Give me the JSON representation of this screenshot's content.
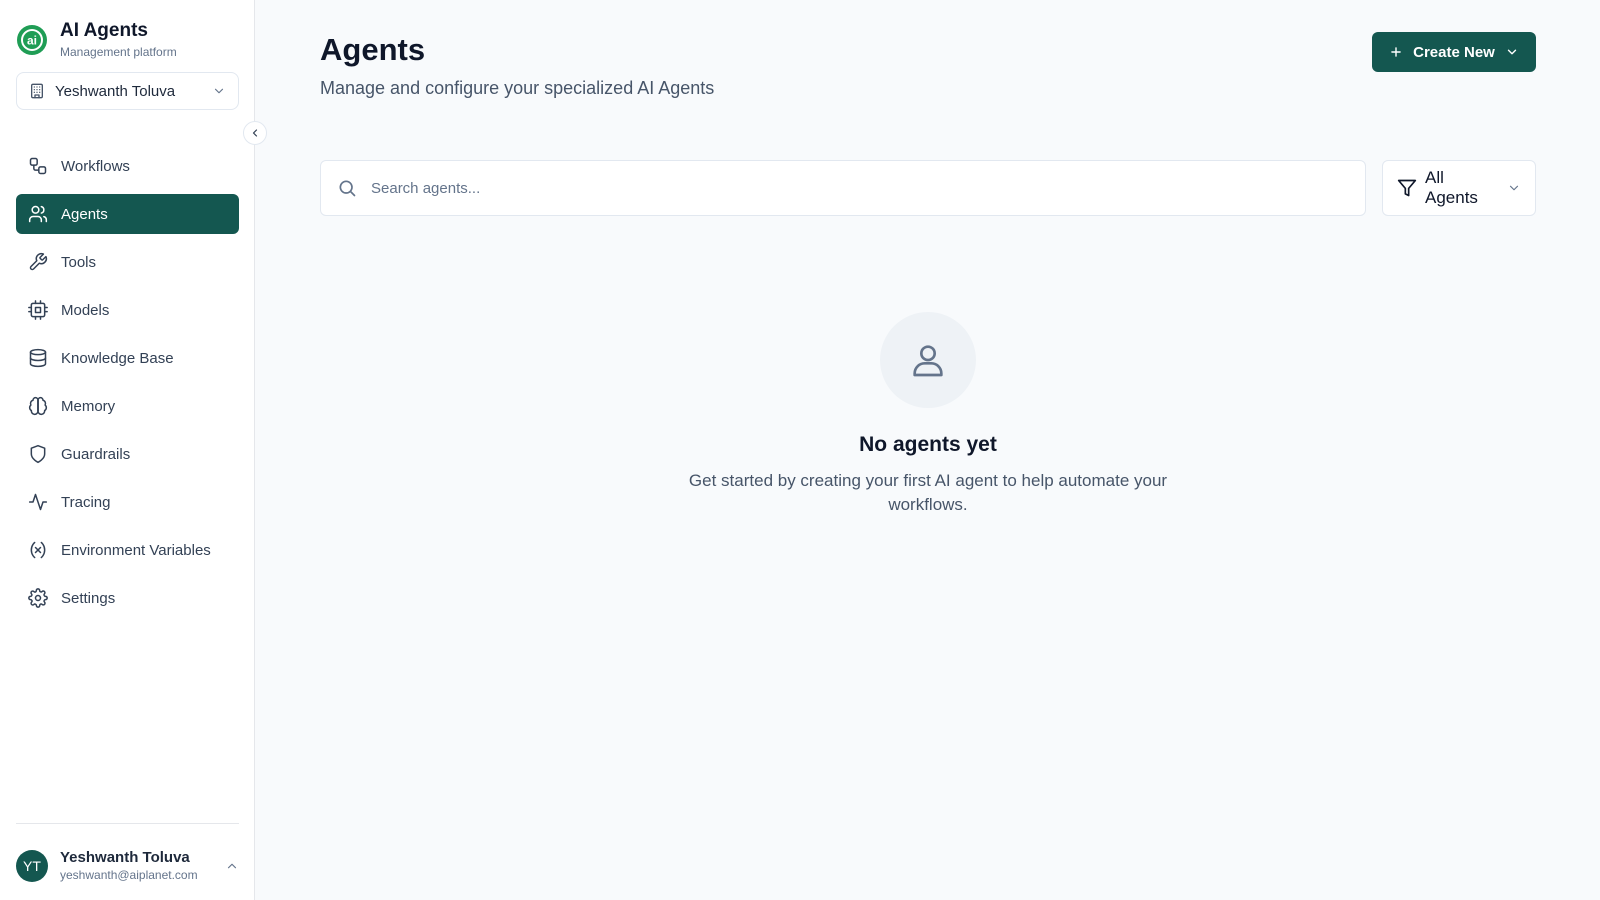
{
  "brand": {
    "title": "AI Agents",
    "subtitle": "Management platform",
    "logo_text": "ai",
    "color": "#1f9d55"
  },
  "org_selector": {
    "value": "Yeshwanth Toluva",
    "icon": "building-icon"
  },
  "sidebar": {
    "items": [
      {
        "label": "Workflows",
        "icon": "workflow-icon",
        "active": false
      },
      {
        "label": "Agents",
        "icon": "users-icon",
        "active": true
      },
      {
        "label": "Tools",
        "icon": "wrench-icon",
        "active": false
      },
      {
        "label": "Models",
        "icon": "cpu-icon",
        "active": false
      },
      {
        "label": "Knowledge Base",
        "icon": "database-icon",
        "active": false
      },
      {
        "label": "Memory",
        "icon": "brain-icon",
        "active": false
      },
      {
        "label": "Guardrails",
        "icon": "shield-icon",
        "active": false
      },
      {
        "label": "Tracing",
        "icon": "activity-icon",
        "active": false
      },
      {
        "label": "Environment Variables",
        "icon": "variable-icon",
        "active": false
      },
      {
        "label": "Settings",
        "icon": "gear-icon",
        "active": false
      }
    ]
  },
  "user": {
    "initials": "YT",
    "name": "Yeshwanth Toluva",
    "email": "yeshwanth@aiplanet.com"
  },
  "header": {
    "title": "Agents",
    "subtitle": "Manage and configure your specialized AI Agents",
    "create_label": "Create New"
  },
  "search": {
    "placeholder": "Search agents...",
    "value": ""
  },
  "filter": {
    "value": "All Agents"
  },
  "empty_state": {
    "title": "No agents yet",
    "description": "Get started by creating your first AI agent to help automate your workflows.",
    "icon": "user-icon"
  },
  "colors": {
    "accent": "#145750",
    "background": "#f8fafc",
    "border": "#e2e8f0"
  }
}
